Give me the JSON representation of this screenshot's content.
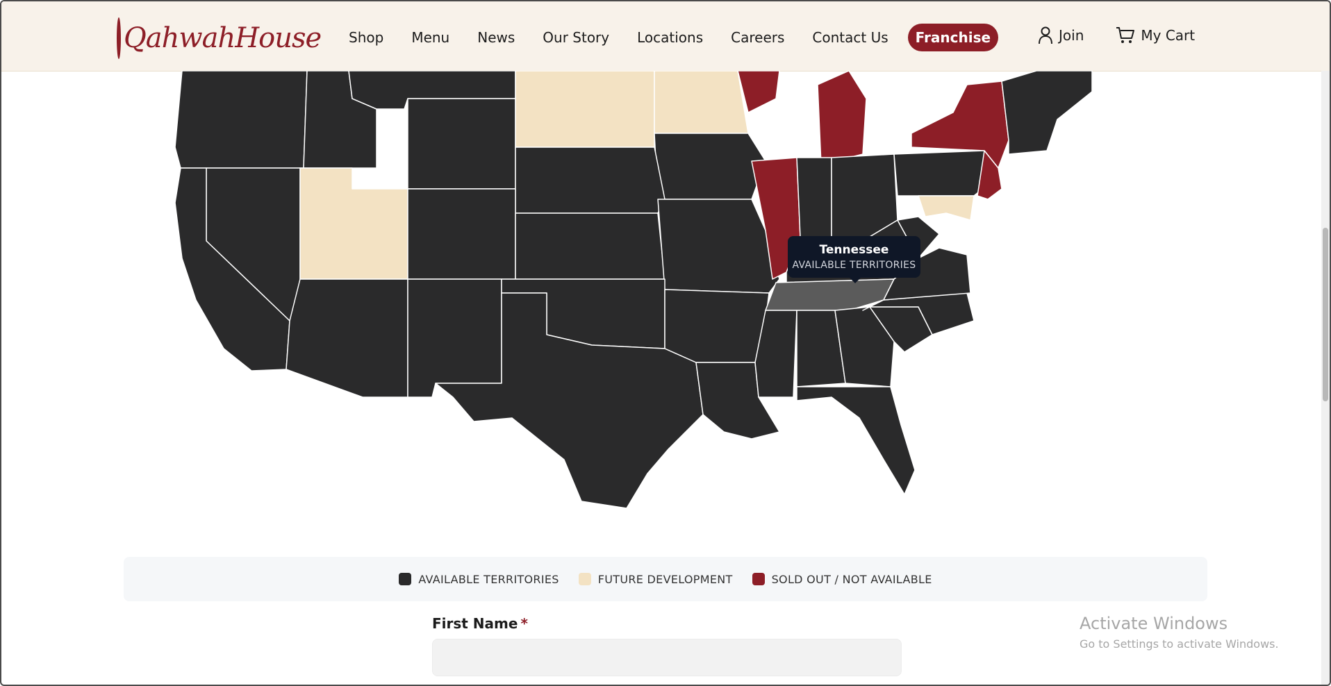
{
  "brand": {
    "logo_text": "QahwahHouse"
  },
  "nav": {
    "items": [
      "Shop",
      "Menu",
      "News",
      "Our Story",
      "Locations",
      "Careers",
      "Contact Us"
    ],
    "franchise_label": "Franchise"
  },
  "user": {
    "join_label": "Join",
    "cart_label": "My Cart"
  },
  "colors": {
    "available": "#2a2a2b",
    "future": "#f3e2c3",
    "sold_out": "#8d1e27",
    "hover": "#5b5b5b"
  },
  "map": {
    "hovered_state": "Tennessee",
    "hovered_status": "AVAILABLE TERRITORIES",
    "sold_out_states": [
      "Illinois",
      "Michigan",
      "New York",
      "New Jersey",
      "Wisconsin"
    ],
    "future_states": [
      "South Dakota",
      "Minnesota",
      "Utah",
      "Maryland"
    ]
  },
  "legend": {
    "available": "AVAILABLE TERRITORIES",
    "future": "FUTURE DEVELOPMENT",
    "sold_out": "SOLD OUT / NOT AVAILABLE"
  },
  "form": {
    "first_name_label": "First Name",
    "required_mark": "*"
  },
  "os_watermark": {
    "line1": "Activate Windows",
    "line2": "Go to Settings to activate Windows."
  }
}
